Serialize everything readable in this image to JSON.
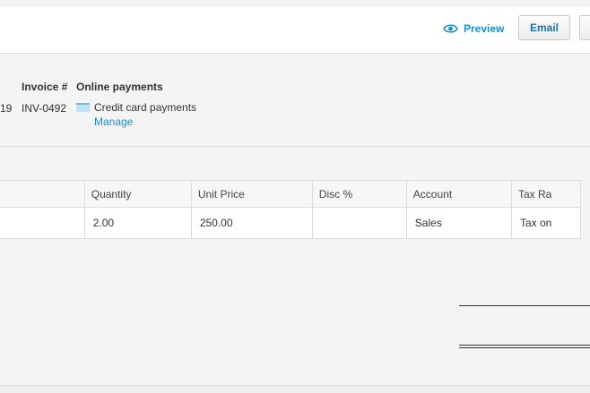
{
  "header": {
    "preview_label": "Preview",
    "email_label": "Email"
  },
  "invoice": {
    "date_fragment": "19",
    "invoice_number_label": "Invoice #",
    "invoice_number": "INV-0492",
    "online_payments_label": "Online payments",
    "payment_method": "Credit card payments",
    "manage_label": "Manage"
  },
  "line_items": {
    "columns": [
      "",
      "Quantity",
      "Unit Price",
      "Disc %",
      "Account",
      "Tax Ra"
    ],
    "rows": [
      {
        "description": "",
        "quantity": "2.00",
        "unit_price": "250.00",
        "discount": "",
        "account": "Sales",
        "tax_rate": "Tax on"
      }
    ]
  },
  "colors": {
    "link": "#1a8fc9",
    "button_text": "#1a6fa6",
    "border": "#dcdcdc"
  }
}
